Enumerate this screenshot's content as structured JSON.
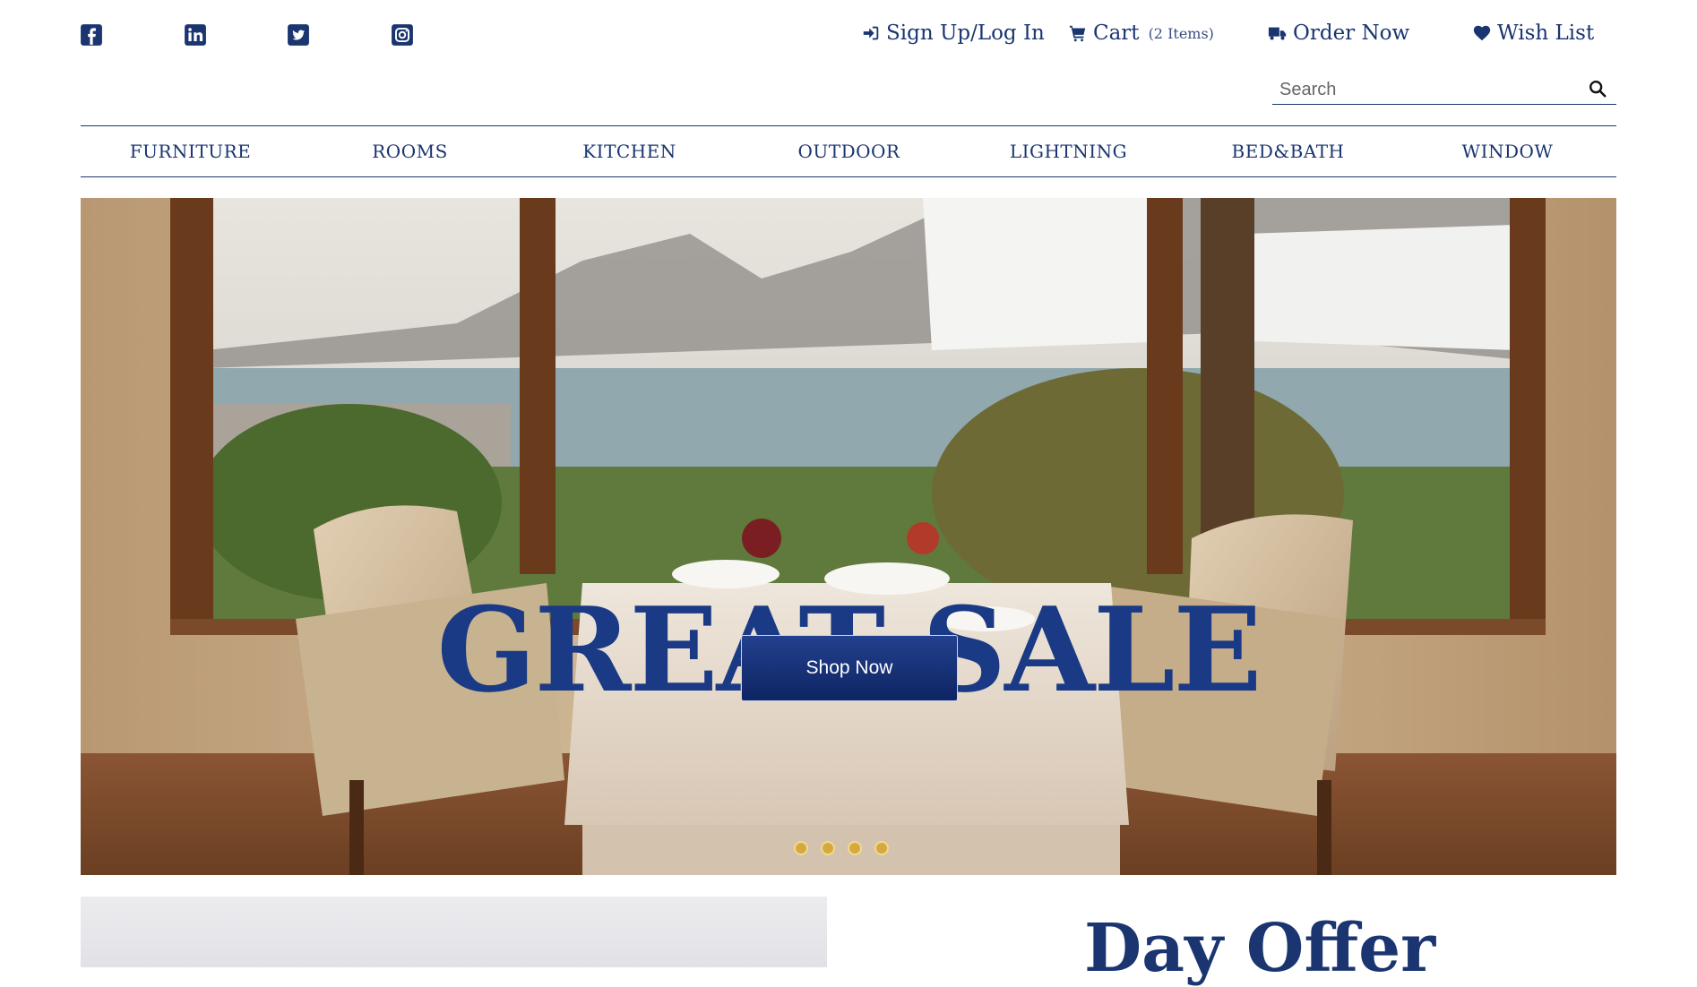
{
  "social": [
    {
      "name": "facebook-icon"
    },
    {
      "name": "linkedin-icon"
    },
    {
      "name": "twitter-icon"
    },
    {
      "name": "instagram-icon"
    }
  ],
  "top_links": {
    "signup": "Sign Up/Log In",
    "cart": "Cart",
    "cart_count": "(2 Items)",
    "order": "Order Now",
    "wishlist": "Wish List"
  },
  "search": {
    "placeholder": "Search"
  },
  "nav": [
    "FURNITURE",
    "ROOMS",
    "KITCHEN",
    "OUTDOOR",
    "LIGHTNING",
    "BED&BATH",
    "WINDOW"
  ],
  "hero": {
    "headline": "GREAT SALE",
    "button": "Shop Now",
    "slide_count": 4
  },
  "offer": {
    "title": "Day Offer"
  },
  "colors": {
    "brand": "#1a3570",
    "button": "#0e2563",
    "dot": "#d6a940"
  }
}
